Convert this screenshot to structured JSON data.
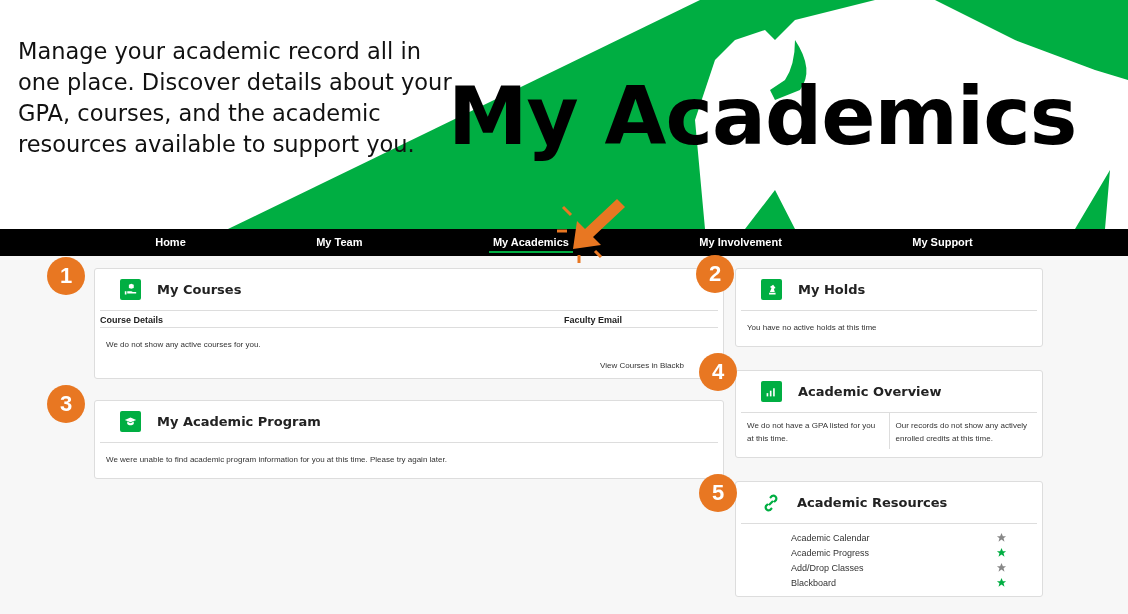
{
  "hero": {
    "description": "Manage your academic record all in one place. Discover details about your GPA, courses, and the academic resources available to support you.",
    "title": "My Academics"
  },
  "nav": [
    {
      "label": "Home",
      "selected": false
    },
    {
      "label": "My Team",
      "selected": false
    },
    {
      "label": "My Academics",
      "selected": true
    },
    {
      "label": "My Involvement",
      "selected": false
    },
    {
      "label": "My Support",
      "selected": false
    }
  ],
  "my_courses": {
    "badge": "1",
    "title": "My Courses",
    "columns": [
      "Course Details",
      "Faculty Email"
    ],
    "message": "We do not show any active courses for you.",
    "link": "View Courses in Blackb"
  },
  "my_academic_program": {
    "badge": "3",
    "title": "My Academic Program",
    "message": "We were unable to find academic program information for you at this time.  Please try again later."
  },
  "my_holds": {
    "badge": "2",
    "title": "My Holds",
    "message": "You have no active holds at this time"
  },
  "academic_overview": {
    "badge": "4",
    "title": "Academic Overview",
    "gpa": "We do not have a GPA listed for you at this time.",
    "credits": "Our records do not show any actively enrolled credits at this time."
  },
  "academic_resources": {
    "badge": "5",
    "title": "Academic Resources",
    "items": [
      {
        "label": "Academic Calendar",
        "favorite": false
      },
      {
        "label": "Academic Progress",
        "favorite": true
      },
      {
        "label": "Add/Drop Classes",
        "favorite": false
      },
      {
        "label": "Blackboard",
        "favorite": true
      }
    ]
  }
}
